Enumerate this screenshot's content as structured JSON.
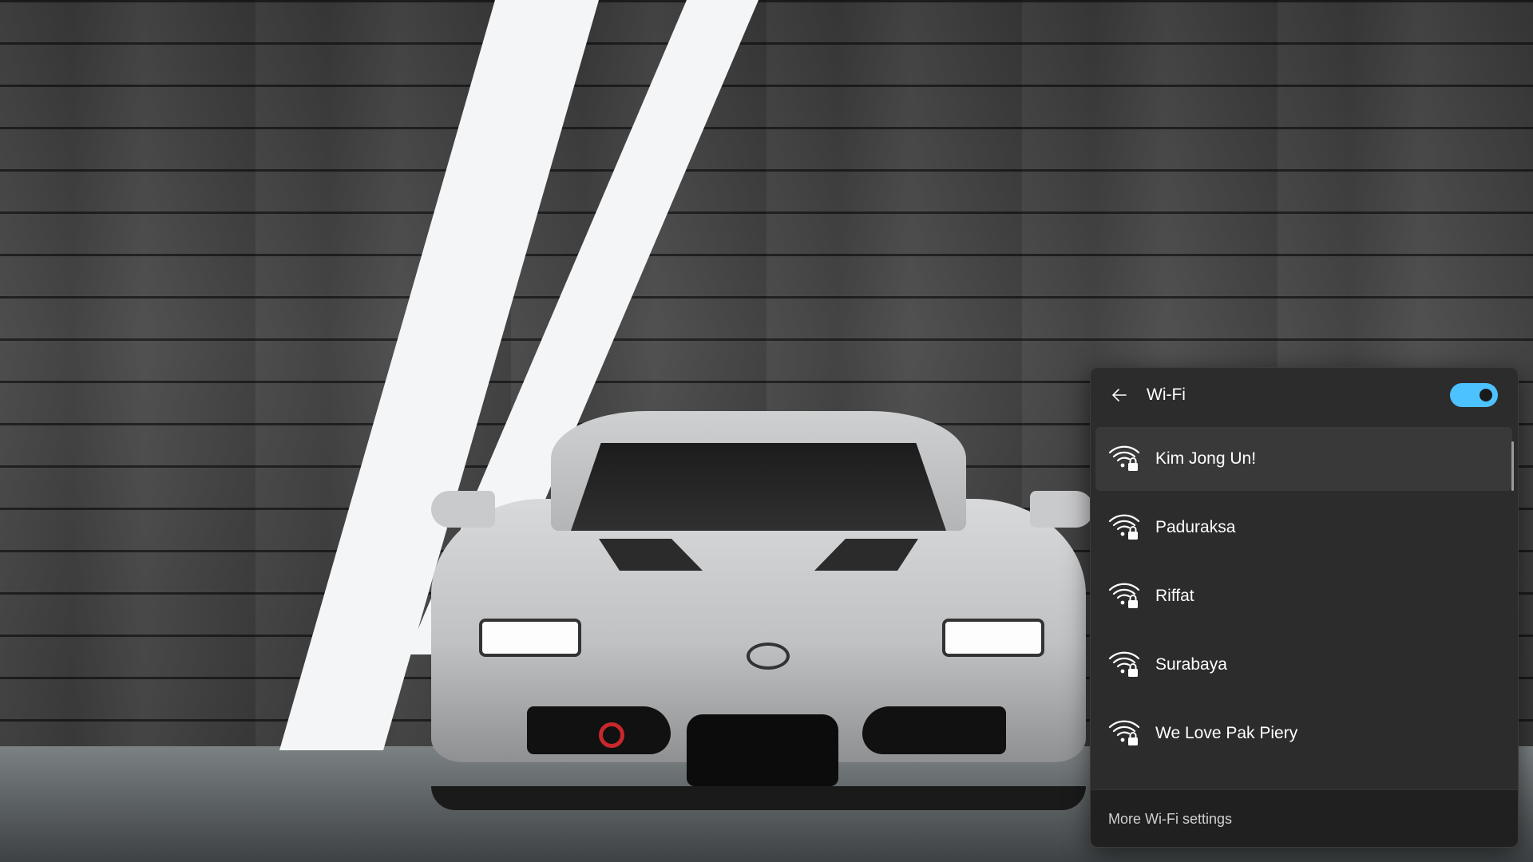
{
  "wifi_panel": {
    "title": "Wi-Fi",
    "back_icon": "arrow-left-icon",
    "toggle_state": "on",
    "accent_color": "#4cc2ff",
    "networks": [
      {
        "name": "Kim Jong Un!",
        "icon": "wifi-secured-icon",
        "selected": true
      },
      {
        "name": "Paduraksa",
        "icon": "wifi-secured-icon",
        "selected": false
      },
      {
        "name": "Riffat",
        "icon": "wifi-secured-icon",
        "selected": false
      },
      {
        "name": "Surabaya",
        "icon": "wifi-secured-icon",
        "selected": false
      },
      {
        "name": "We Love Pak Piery",
        "icon": "wifi-secured-icon",
        "selected": false
      }
    ],
    "footer_link": "More Wi-Fi settings"
  }
}
